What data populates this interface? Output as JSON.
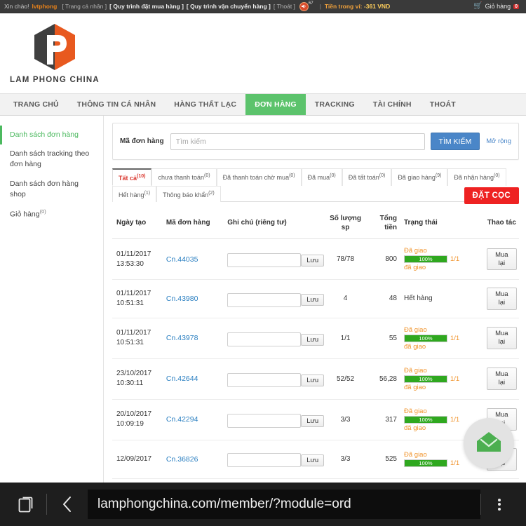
{
  "topbar": {
    "greeting": "Xin chào!",
    "username": "lvtphong",
    "links": [
      {
        "label": "[ Trang cá nhân ]",
        "bold": false
      },
      {
        "label": "[ Quy trình đặt mua hàng ]",
        "bold": true
      },
      {
        "label": "[ Quy trình vận chuyển hàng ]",
        "bold": true
      },
      {
        "label": "[ Thoát ]",
        "bold": false
      }
    ],
    "speaker_count": "67",
    "separator": "|",
    "wallet_label": "Tiền trong ví:",
    "wallet_value": "-361 VND",
    "cart_label": "Giỏ hàng",
    "cart_count": "0"
  },
  "brand": {
    "name": "LAM PHONG CHINA",
    "dark": "#3f3f3f",
    "orange": "#e8591f"
  },
  "mainnav": {
    "items": [
      {
        "label": "TRANG CHỦ",
        "active": false
      },
      {
        "label": "THÔNG TIN CÁ NHÂN",
        "active": false
      },
      {
        "label": "HÀNG THẤT LẠC",
        "active": false
      },
      {
        "label": "ĐƠN HÀNG",
        "active": true
      },
      {
        "label": "TRACKING",
        "active": false
      },
      {
        "label": "TÀI CHÍNH",
        "active": false
      },
      {
        "label": "THOÁT",
        "active": false
      }
    ],
    "active_color": "#5cc36c"
  },
  "sidebar": {
    "items": [
      {
        "label": "Danh sách đơn hàng",
        "sup": "",
        "active": true
      },
      {
        "label": "Danh sách tracking theo đơn hàng",
        "sup": "",
        "active": false
      },
      {
        "label": "Danh sách đơn hàng shop",
        "sup": "",
        "active": false
      },
      {
        "label": "Giỏ hàng",
        "sup": "(0)",
        "active": false
      }
    ]
  },
  "search": {
    "label": "Mã đơn hàng",
    "placeholder": "Tìm kiếm",
    "value": "",
    "button": "TÌM KIẾM",
    "expand": "Mở rộng"
  },
  "tabs": {
    "items": [
      {
        "label": "Tất cả",
        "count": "(10)",
        "active": true
      },
      {
        "label": "chưa thanh toán",
        "count": "(0)",
        "active": false
      },
      {
        "label": "Đã thanh toán chờ mua",
        "count": "(0)",
        "active": false
      },
      {
        "label": "Đã mua",
        "count": "(0)",
        "active": false
      },
      {
        "label": "Đã tất toán",
        "count": "(0)",
        "active": false
      },
      {
        "label": "Đã giao hàng",
        "count": "(9)",
        "active": false
      },
      {
        "label": "Đã nhận hàng",
        "count": "(0)",
        "active": false
      },
      {
        "label": "Hết hàng",
        "count": "(1)",
        "active": false
      },
      {
        "label": "Thông báo khẩn",
        "count": "(2)",
        "active": false
      }
    ],
    "deposit_button": "ĐẶT CỌC",
    "deposit_color": "#ee2222"
  },
  "table": {
    "headers": [
      "Ngày tạo",
      "Mã đơn hàng",
      "Ghi chú (riêng tư)",
      "Số lượng sp",
      "Tổng tiền",
      "Trạng thái",
      "Thao tác"
    ],
    "save_label": "Lưu",
    "rebuy_label": "Mua lại",
    "note_placeholder": "",
    "rows": [
      {
        "date": "01/11/2017",
        "time": "13:53:30",
        "code": "Cn.44035",
        "note": "",
        "qty": "78/78",
        "total": "800",
        "status_type": "progress",
        "status_top": "Đã giao",
        "progress_label": "100%",
        "progress_pct": 100,
        "fraction": "1/1",
        "status_bottom": "đã giao"
      },
      {
        "date": "01/11/2017",
        "time": "10:51:31",
        "code": "Cn.43980",
        "note": "",
        "qty": "4",
        "total": "48",
        "status_type": "plain",
        "status_text": "Hết hàng"
      },
      {
        "date": "01/11/2017",
        "time": "10:51:31",
        "code": "Cn.43978",
        "note": "",
        "qty": "1/1",
        "total": "55",
        "status_type": "progress",
        "status_top": "Đã giao",
        "progress_label": "100%",
        "progress_pct": 100,
        "fraction": "1/1",
        "status_bottom": "đã giao"
      },
      {
        "date": "23/10/2017",
        "time": "10:30:11",
        "code": "Cn.42644",
        "note": "",
        "qty": "52/52",
        "total": "56,28",
        "status_type": "progress",
        "status_top": "Đã giao",
        "progress_label": "100%",
        "progress_pct": 100,
        "fraction": "1/1",
        "status_bottom": "đã giao"
      },
      {
        "date": "20/10/2017",
        "time": "10:09:19",
        "code": "Cn.42294",
        "note": "",
        "qty": "3/3",
        "total": "317",
        "status_type": "progress",
        "status_top": "Đã giao",
        "progress_label": "100%",
        "progress_pct": 100,
        "fraction": "1/1",
        "status_bottom": "đã giao"
      },
      {
        "date": "12/09/2017",
        "time": "",
        "code": "Cn.36826",
        "note": "",
        "qty": "3/3",
        "total": "525",
        "status_type": "progress",
        "status_top": "Đã giao",
        "progress_label": "100%",
        "progress_pct": 100,
        "fraction": "1/1",
        "status_bottom": ""
      }
    ]
  },
  "fab": {
    "icon": "envelope-icon",
    "color": "#4caf50"
  },
  "browserbar": {
    "url": "lamphongchina.com/member/?module=ord",
    "tabs_icon": "tabs-icon",
    "back_icon": "back-chevron-icon",
    "menu_icon": "overflow-menu-icon"
  }
}
